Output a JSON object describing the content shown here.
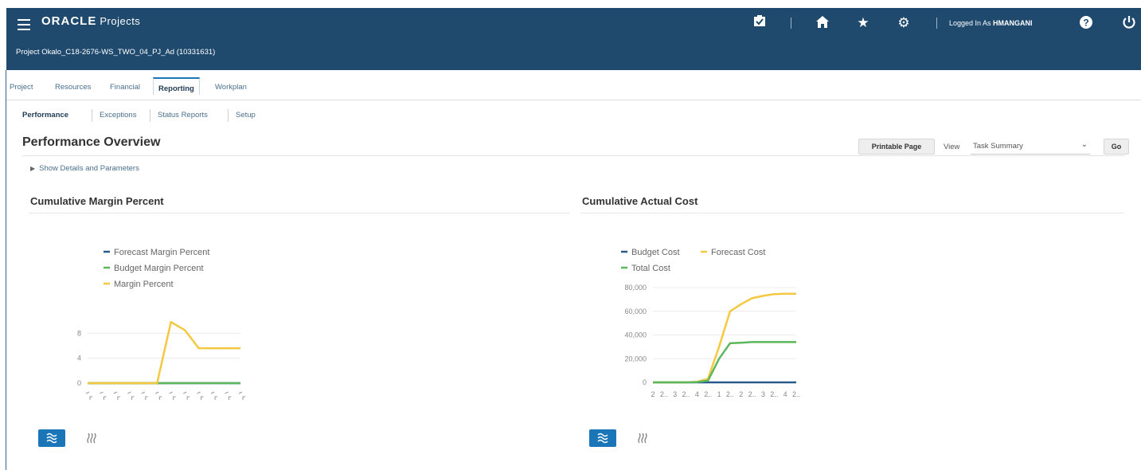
{
  "app": {
    "brand": "ORACLE",
    "product": "Projects",
    "project_title": "Project Okalo_C18-2676-WS_TWO_04_PJ_Ad (10331631)"
  },
  "header": {
    "logged_in_prefix": "Logged In As ",
    "user": "HMANGANI",
    "icons": [
      "inbox-icon",
      "home-icon",
      "favorites-star-icon",
      "gear-icon",
      "help-icon",
      "power-icon"
    ]
  },
  "tabs": [
    {
      "label": "Project"
    },
    {
      "label": "Resources"
    },
    {
      "label": "Financial"
    },
    {
      "label": "Reporting",
      "active": true
    },
    {
      "label": "Workplan"
    }
  ],
  "subtabs": [
    {
      "label": "Performance",
      "active": true
    },
    {
      "label": "Exceptions"
    },
    {
      "label": "Status Reports"
    },
    {
      "label": "Setup"
    }
  ],
  "page": {
    "title": "Performance Overview",
    "printable_label": "Printable Page",
    "view_label": "View",
    "view_value": "Task Summary",
    "go_label": "Go",
    "show_details": "Show Details and Parameters"
  },
  "colors": {
    "header_bg": "#1f4a6e",
    "accent": "#1b76b8",
    "forecast": "#2a5b8c",
    "budget": "#5cb85c",
    "margin": "#f5c842"
  },
  "chart_data": [
    {
      "type": "line",
      "title": "Cumulative Margin Percent",
      "x_tick_marks": "rotated, illegible",
      "x": [
        0,
        1,
        2,
        3,
        4,
        5,
        6,
        7,
        8,
        9,
        10,
        11
      ],
      "y_ticks": [
        "0",
        "4",
        "8"
      ],
      "ylim": [
        0,
        12
      ],
      "series": [
        {
          "name": "Forecast Margin Percent",
          "color": "#2a5b8c",
          "values": [
            0,
            0,
            0,
            0,
            0,
            0,
            0,
            0,
            0,
            0,
            0,
            0
          ]
        },
        {
          "name": "Budget Margin Percent",
          "color": "#5cb85c",
          "values": [
            0,
            0,
            0,
            0,
            0,
            0,
            0,
            0,
            0,
            0,
            0,
            0
          ]
        },
        {
          "name": "Margin Percent",
          "color": "#f5c842",
          "values": [
            0,
            0,
            0,
            0,
            0,
            0,
            9.8,
            8.5,
            5.6,
            5.6,
            5.6,
            5.6
          ]
        }
      ],
      "legend": "top",
      "grid": true
    },
    {
      "type": "line",
      "title": "Cumulative Actual Cost",
      "categories": [
        "2",
        "2..",
        "3",
        "2..",
        "4",
        "2..",
        "1",
        "2..",
        "2",
        "2..",
        "3",
        "2..",
        "4",
        "2.."
      ],
      "y_ticks": [
        "0",
        "20,000",
        "40,000",
        "60,000",
        "80,000"
      ],
      "ylim": [
        0,
        80000
      ],
      "series": [
        {
          "name": "Budget Cost",
          "color": "#2a5b8c",
          "values": [
            0,
            0,
            0,
            0,
            0,
            0,
            0,
            0,
            0,
            0,
            0,
            0,
            0,
            0
          ]
        },
        {
          "name": "Forecast Cost",
          "color": "#f5c842",
          "values": [
            0,
            0,
            0,
            0,
            500,
            3000,
            30000,
            60000,
            66000,
            71000,
            73000,
            74500,
            74800,
            74800
          ]
        },
        {
          "name": "Total Cost",
          "color": "#5cb85c",
          "values": [
            0,
            0,
            0,
            0,
            300,
            1500,
            20000,
            33000,
            33500,
            34000,
            34000,
            34000,
            34000,
            34000
          ]
        }
      ],
      "legend": "top",
      "grid": true
    }
  ]
}
